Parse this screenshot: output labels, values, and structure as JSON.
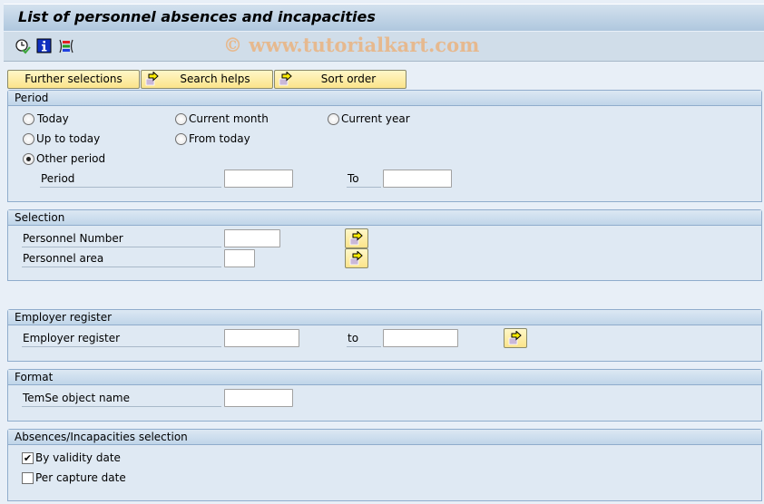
{
  "window": {
    "title": "List of personnel absences and incapacities"
  },
  "toolbar": {
    "icons": [
      "execute-clock-icon",
      "info-icon",
      "variant-icon"
    ],
    "watermark": "© www.tutorialkart.com"
  },
  "tabs": [
    {
      "label": "Further selections",
      "icon": null
    },
    {
      "label": "Search helps",
      "icon": "arrow-right-icon"
    },
    {
      "label": "Sort order",
      "icon": "arrow-right-icon"
    }
  ],
  "period": {
    "header": "Period",
    "options": [
      {
        "label": "Today",
        "selected": false
      },
      {
        "label": "Current month",
        "selected": false
      },
      {
        "label": "Current year",
        "selected": false
      },
      {
        "label": "Up to today",
        "selected": false
      },
      {
        "label": "From today",
        "selected": false
      },
      {
        "label": "Other period",
        "selected": true
      }
    ],
    "period_label": "Period",
    "period_from": "",
    "to_label": "To",
    "period_to": ""
  },
  "selection": {
    "header": "Selection",
    "fields": [
      {
        "label": "Personnel Number",
        "value": ""
      },
      {
        "label": "Personnel area",
        "value": ""
      }
    ]
  },
  "employer_register": {
    "header": "Employer register",
    "label": "Employer register",
    "from": "",
    "to_label": "to",
    "to": ""
  },
  "format": {
    "header": "Format",
    "temse_label": "TemSe object name",
    "temse_value": ""
  },
  "absences": {
    "header": "Absences/Incapacities selection",
    "options": [
      {
        "label": "By validity date",
        "checked": true
      },
      {
        "label": "Per capture date",
        "checked": false
      }
    ]
  }
}
